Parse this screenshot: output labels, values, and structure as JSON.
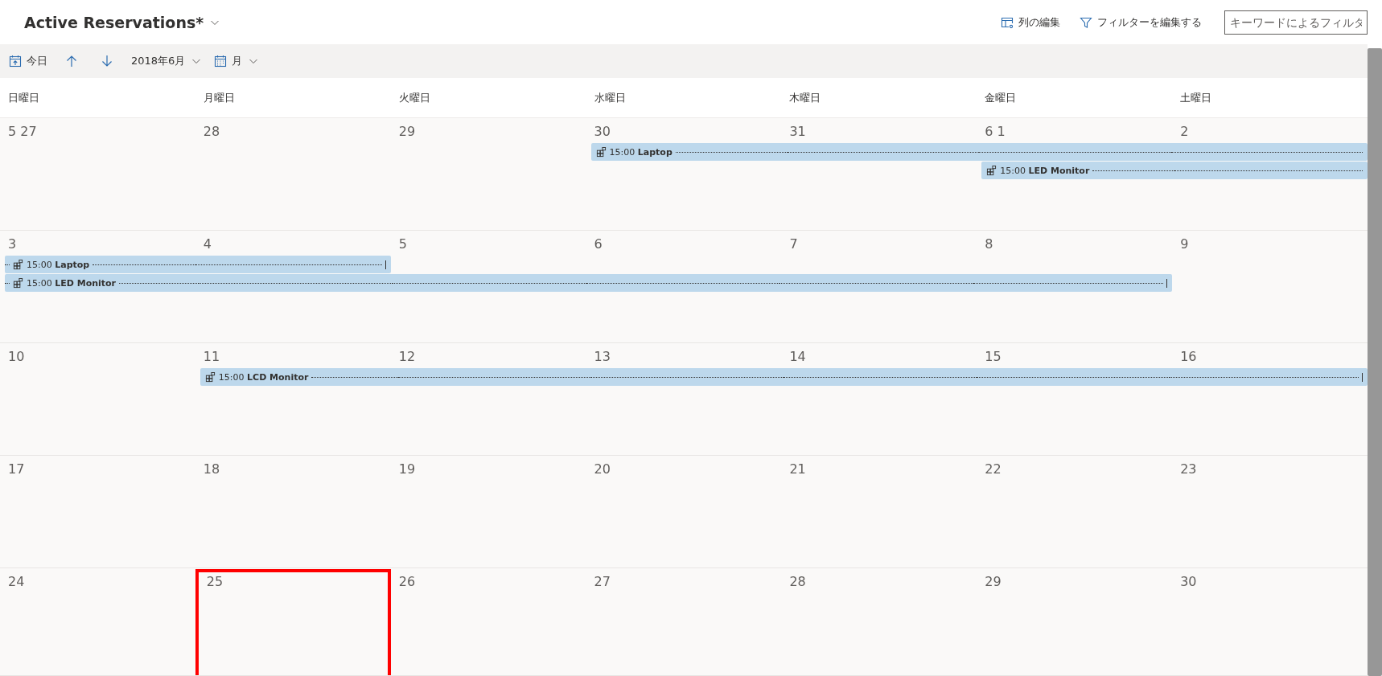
{
  "view": {
    "title": "Active Reservations*"
  },
  "commands": [
    {
      "kind": "columns",
      "label": "列の編集"
    },
    {
      "kind": "filter",
      "label": "フィルターを編集する"
    }
  ],
  "search": {
    "placeholder": "キーワードによるフィルタ"
  },
  "toolbar": {
    "today": "今日",
    "period": "2018年6月",
    "view_mode": "月"
  },
  "weekdays": [
    "日曜日",
    "月曜日",
    "火曜日",
    "水曜日",
    "木曜日",
    "金曜日",
    "土曜日"
  ],
  "weeks": [
    {
      "days": [
        {
          "label": "5 27",
          "highlighted": false
        },
        {
          "label": "28",
          "highlighted": false
        },
        {
          "label": "29",
          "highlighted": false
        },
        {
          "label": "30",
          "highlighted": false
        },
        {
          "label": "31",
          "highlighted": false
        },
        {
          "label": "6 1",
          "highlighted": false
        },
        {
          "label": "2",
          "highlighted": false
        }
      ],
      "events": [
        {
          "time": "15:00",
          "title": "Laptop",
          "covers": [
            false,
            false,
            false,
            true,
            true,
            true,
            true
          ],
          "continued": false,
          "ends": false
        },
        {
          "time": "15:00",
          "title": "LED Monitor",
          "covers": [
            false,
            false,
            false,
            false,
            false,
            true,
            true
          ],
          "continued": false,
          "ends": false
        }
      ]
    },
    {
      "days": [
        {
          "label": "3",
          "highlighted": false
        },
        {
          "label": "4",
          "highlighted": false
        },
        {
          "label": "5",
          "highlighted": false
        },
        {
          "label": "6",
          "highlighted": false
        },
        {
          "label": "7",
          "highlighted": false
        },
        {
          "label": "8",
          "highlighted": false
        },
        {
          "label": "9",
          "highlighted": false
        }
      ],
      "events": [
        {
          "time": "15:00",
          "title": "Laptop",
          "covers": [
            true,
            true,
            false,
            false,
            false,
            false,
            false
          ],
          "continued": true,
          "ends": true
        },
        {
          "time": "15:00",
          "title": "LED Monitor",
          "covers": [
            true,
            true,
            true,
            true,
            true,
            true,
            false
          ],
          "continued": true,
          "ends": true
        }
      ]
    },
    {
      "days": [
        {
          "label": "10",
          "highlighted": false
        },
        {
          "label": "11",
          "highlighted": false
        },
        {
          "label": "12",
          "highlighted": false
        },
        {
          "label": "13",
          "highlighted": false
        },
        {
          "label": "14",
          "highlighted": false
        },
        {
          "label": "15",
          "highlighted": false
        },
        {
          "label": "16",
          "highlighted": false
        }
      ],
      "events": [
        {
          "time": "15:00",
          "title": "LCD Monitor",
          "covers": [
            false,
            true,
            true,
            true,
            true,
            true,
            true
          ],
          "continued": false,
          "ends": true
        }
      ]
    },
    {
      "days": [
        {
          "label": "17",
          "highlighted": false
        },
        {
          "label": "18",
          "highlighted": false
        },
        {
          "label": "19",
          "highlighted": false
        },
        {
          "label": "20",
          "highlighted": false
        },
        {
          "label": "21",
          "highlighted": false
        },
        {
          "label": "22",
          "highlighted": false
        },
        {
          "label": "23",
          "highlighted": false
        }
      ]
    },
    {
      "days": [
        {
          "label": "24",
          "highlighted": false
        },
        {
          "label": "25",
          "highlighted": true
        },
        {
          "label": "26",
          "highlighted": false
        },
        {
          "label": "27",
          "highlighted": false
        },
        {
          "label": "28",
          "highlighted": false
        },
        {
          "label": "29",
          "highlighted": false
        },
        {
          "label": "30",
          "highlighted": false
        }
      ]
    }
  ]
}
